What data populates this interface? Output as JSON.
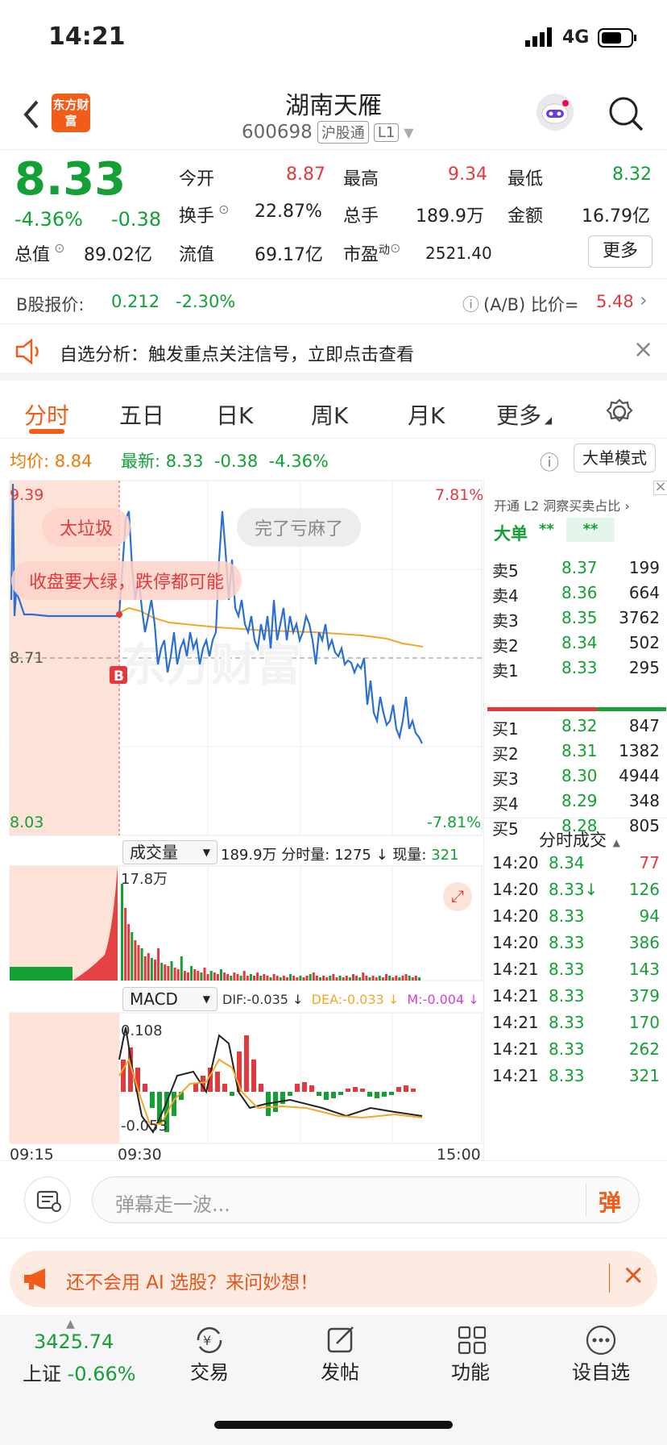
{
  "status": {
    "time": "14:21",
    "network": "4G"
  },
  "header": {
    "title": "湖南天雁",
    "code": "600698",
    "tag1": "沪股通",
    "tag2": "L1",
    "logo": "东方财富"
  },
  "quote": {
    "price": "8.33",
    "pct": "-4.36%",
    "chg": "-0.38",
    "fields": [
      {
        "label": "今开",
        "value": "8.87"
      },
      {
        "label": "最高",
        "value": "9.34"
      },
      {
        "label": "最低",
        "value": "8.32"
      },
      {
        "label": "换手",
        "value": "22.87%"
      },
      {
        "label": "总手",
        "value": "189.9万"
      },
      {
        "label": "金额",
        "value": "16.79亿"
      },
      {
        "label": "总值",
        "value": "89.02亿"
      },
      {
        "label": "流值",
        "value": "69.17亿"
      },
      {
        "label": "市盈",
        "sup": "动",
        "value": "2521.40"
      }
    ],
    "more": "更多"
  },
  "bshare": {
    "label": "B股报价:",
    "price": "0.212",
    "pct": "-2.30%",
    "ratio_label": "(A/B) 比价=",
    "ratio": "5.48"
  },
  "notice": {
    "text": "自选分析：触发重点关注信号，立即点击查看"
  },
  "tabs": [
    "分时",
    "五日",
    "日K",
    "周K",
    "月K",
    "更多"
  ],
  "infobar": {
    "avg_label": "均价:",
    "avg": "8.84",
    "latest_label": "最新:",
    "latest": "8.33",
    "chg": "-0.38",
    "pct": "-4.36%",
    "mode": "大单模式"
  },
  "chart": {
    "y_top": "9.39",
    "y_mid": "8.71",
    "y_bot": "8.03",
    "pct_top": "7.81%",
    "pct_bot": "-7.81%",
    "vol_label": "成交量",
    "vol_total": "189.9万",
    "vol_fs_label": "分时量:",
    "vol_fs": "1275",
    "vol_now_label": "现量:",
    "vol_now": "321",
    "vol_max": "17.8万",
    "macd_label": "MACD",
    "dif": "DIF:-0.035",
    "dea": "DEA:-0.033",
    "m": "M:-0.004",
    "macd_top": "0.108",
    "macd_bot": "-0.053",
    "x_start": "09:15",
    "x_mid": "09:30",
    "x_end": "15:00",
    "marker": "B",
    "danmaku": [
      "太垃圾",
      "完了亏麻了",
      "收盘要大绿，跌停都可能"
    ],
    "watermark": "东方财富"
  },
  "level2": {
    "title": "开通 L2 洞察买卖占比",
    "big_label": "大单",
    "big_a": "**",
    "big_b": "**",
    "sells": [
      {
        "l": "卖5",
        "p": "8.37",
        "v": "199"
      },
      {
        "l": "卖4",
        "p": "8.36",
        "v": "664"
      },
      {
        "l": "卖3",
        "p": "8.35",
        "v": "3762"
      },
      {
        "l": "卖2",
        "p": "8.34",
        "v": "502"
      },
      {
        "l": "卖1",
        "p": "8.33",
        "v": "295"
      }
    ],
    "buys": [
      {
        "l": "买1",
        "p": "8.32",
        "v": "847"
      },
      {
        "l": "买2",
        "p": "8.31",
        "v": "1382"
      },
      {
        "l": "买3",
        "p": "8.30",
        "v": "4944"
      },
      {
        "l": "买4",
        "p": "8.29",
        "v": "348"
      },
      {
        "l": "买5",
        "p": "8.28",
        "v": "805"
      }
    ],
    "trades_title": "分时成交",
    "trades": [
      {
        "t": "14:20",
        "p": "8.34",
        "v": "77"
      },
      {
        "t": "14:20",
        "p": "8.33↓",
        "v": "126"
      },
      {
        "t": "14:20",
        "p": "8.33",
        "v": "94"
      },
      {
        "t": "14:20",
        "p": "8.33",
        "v": "386"
      },
      {
        "t": "14:21",
        "p": "8.33",
        "v": "143"
      },
      {
        "t": "14:21",
        "p": "8.33",
        "v": "379"
      },
      {
        "t": "14:21",
        "p": "8.33",
        "v": "170"
      },
      {
        "t": "14:21",
        "p": "8.33",
        "v": "262"
      },
      {
        "t": "14:21",
        "p": "8.33",
        "v": "321"
      }
    ]
  },
  "danmu_input": {
    "placeholder": "弹幕走一波...",
    "send": "弹"
  },
  "ai_banner": {
    "text": "还不会用 AI 选股？来问妙想！"
  },
  "navbar": {
    "index_value": "3425.74",
    "index_name": "上证",
    "index_pct": "-0.66%",
    "items": [
      {
        "label": "交易"
      },
      {
        "label": "发帖"
      },
      {
        "label": "功能"
      },
      {
        "label": "设自选"
      }
    ]
  }
}
